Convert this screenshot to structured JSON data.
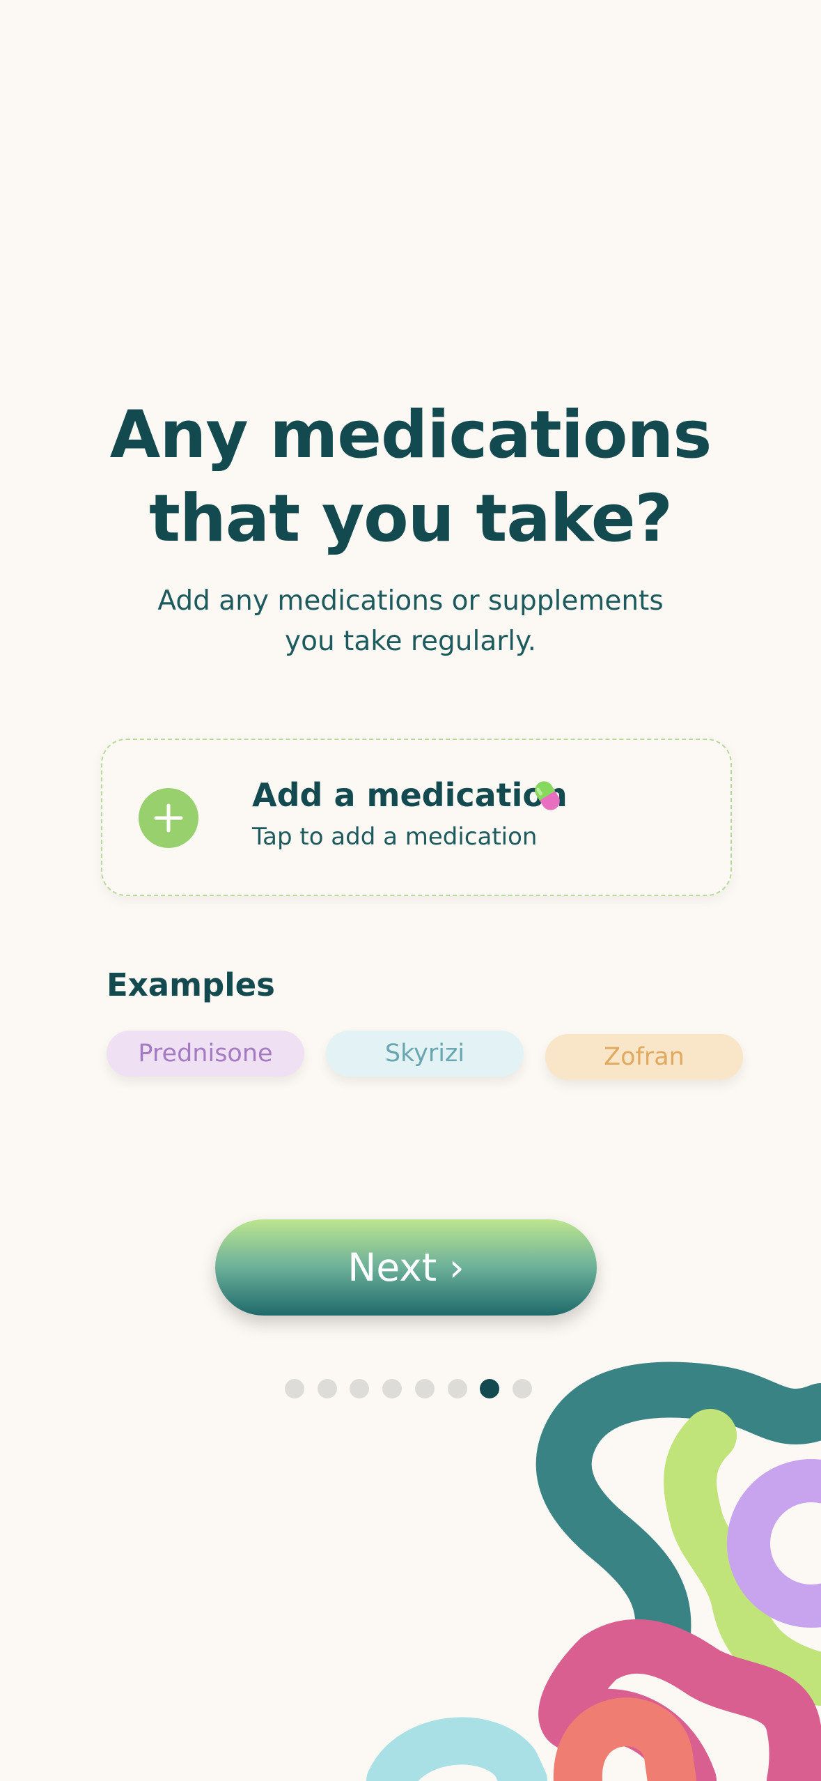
{
  "title_line1": "Any medications",
  "title_line2": "that you take?",
  "subtitle_line1": "Add any medications or supplements",
  "subtitle_line2": "you take regularly.",
  "add_card": {
    "title": "Add a medication",
    "subtitle": "Tap to add a medication",
    "plus_icon": "plus-icon",
    "pill_icon": "pill-icon"
  },
  "examples": {
    "heading": "Examples",
    "chips": [
      "Prednisone",
      "Skyrizi",
      "Zofran"
    ]
  },
  "next_button": "Next ›",
  "pagination": {
    "total": 8,
    "current": 7
  },
  "colors": {
    "background": "#fcf8f3",
    "primary_text": "#134a50",
    "plus_green": "#97d06c",
    "chip_prednisone": "#efe1f3",
    "chip_skyrizi": "#e3f3f5",
    "chip_zofran": "#f9e6c8",
    "dot_active": "#124a4f",
    "dot_inactive": "#dedcd8"
  }
}
